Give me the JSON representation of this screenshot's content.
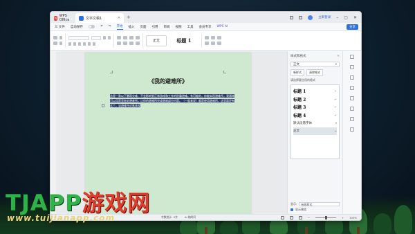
{
  "titlebar": {
    "app_tab": "WPS Office",
    "doc_tab": "文字文稿1",
    "login": "立即登录"
  },
  "menubar": {
    "file": "三 文件",
    "auto_save": "自动保存",
    "items": [
      "开始",
      "插入",
      "页面",
      "引用",
      "审阅",
      "视图",
      "工具",
      "会员专享"
    ],
    "ai": "WPS AI",
    "share": "分享"
  },
  "ribbon": {
    "style_normal": "正文",
    "style_heading1": "标题 1"
  },
  "document": {
    "title": "《我的避难所》",
    "paragraph": "这是一款以下暴雨灾难、不会影响到正常游戏和工作的防震避难。有可能的，你能实现避难所，我通常可以用家里各处避难所，让你的避难所完成避难部分内容。（一般来说）都是使用避难所，这里面还有这个，该避难所对象体现",
    "paragraph_mark": "¶"
  },
  "panel": {
    "header": "样式和格式",
    "current_style": "正文",
    "new_style": "新样式",
    "clear_format": "清除格式",
    "list_label": "请选择要应用的格式",
    "styles": [
      {
        "label": "标题 1",
        "mark": "↵"
      },
      {
        "label": "标题 2",
        "mark": "↵"
      },
      {
        "label": "标题 3",
        "mark": "↵"
      },
      {
        "label": "标题 4",
        "mark": "↵"
      },
      {
        "label": "默认段落字体",
        "mark": "a"
      },
      {
        "label": "正文",
        "mark": "↵"
      }
    ],
    "show_label": "显示:",
    "show_value": "有效样式",
    "preview_label": "显示预览"
  },
  "statusbar": {
    "words": "字数统计: 0字",
    "ai": "AI 随时问",
    "zoom": "100%"
  },
  "watermark": {
    "main_latin": "TJAPP",
    "main_cn": "游戏网",
    "sub": "www.tuijianapp.com"
  }
}
